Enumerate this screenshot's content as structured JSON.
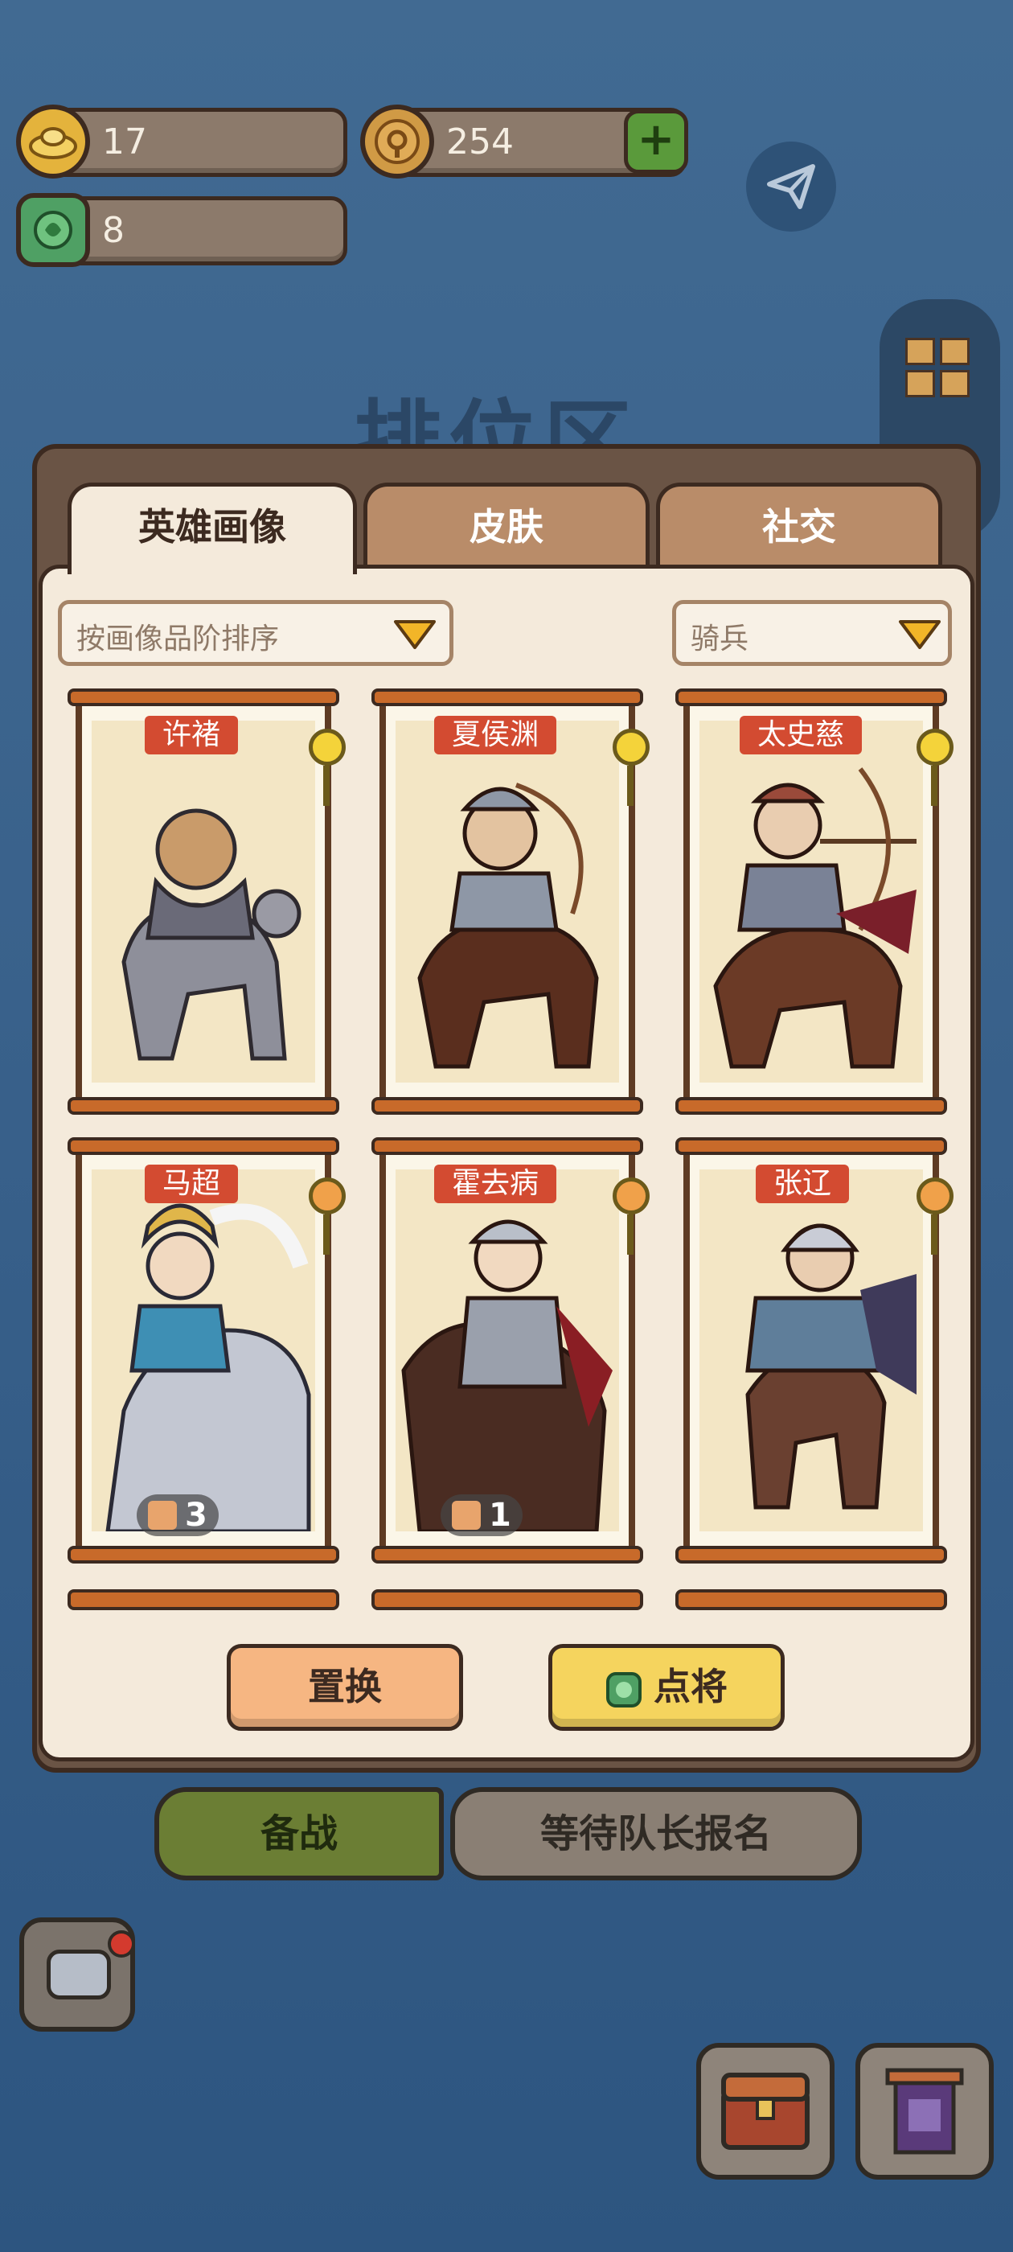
{
  "currency": {
    "gold": "17",
    "coin": "254",
    "jade": "8"
  },
  "background_title": "排位区",
  "tabs": [
    {
      "label": "英雄画像",
      "active": true
    },
    {
      "label": "皮肤",
      "active": false
    },
    {
      "label": "社交",
      "active": false
    }
  ],
  "filters": {
    "sort": "按画像品阶排序",
    "type": "骑兵"
  },
  "heroes": [
    {
      "name": "许褚",
      "pin": "gold"
    },
    {
      "name": "夏侯渊",
      "pin": "gold"
    },
    {
      "name": "太史慈",
      "pin": "gold"
    },
    {
      "name": "马超",
      "pin": "orange",
      "count": "3"
    },
    {
      "name": "霍去病",
      "pin": "orange",
      "count": "1"
    },
    {
      "name": "张辽",
      "pin": "orange"
    }
  ],
  "actions": {
    "swap": "置换",
    "pick": "点将"
  },
  "bottom_bar": {
    "ready": "备战",
    "waiting": "等待队长报名"
  },
  "colors": {
    "background": "#3a5f84",
    "panel": "#f4eadb",
    "name_tag": "#d34b31",
    "ready_button": "#6b7e34",
    "pick_button": "#f5d45e",
    "swap_button": "#f6b682"
  }
}
